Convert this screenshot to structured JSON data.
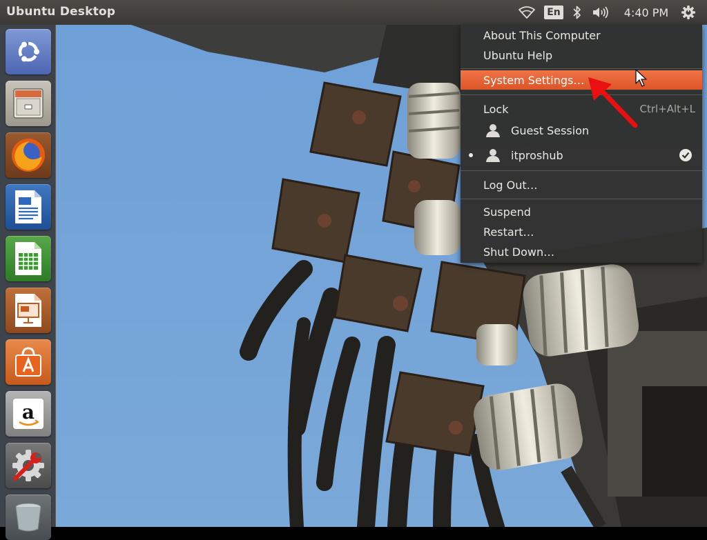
{
  "panel": {
    "title": "Ubuntu Desktop",
    "language": "En",
    "clock": "4:40 PM"
  },
  "launcher": {
    "items": [
      {
        "name": "Dash Home",
        "icon": "ubuntu-logo-icon"
      },
      {
        "name": "Files",
        "icon": "file-cabinet-icon"
      },
      {
        "name": "Firefox Web Browser",
        "icon": "firefox-icon"
      },
      {
        "name": "LibreOffice Writer",
        "icon": "writer-document-icon"
      },
      {
        "name": "LibreOffice Calc",
        "icon": "calc-spreadsheet-icon"
      },
      {
        "name": "LibreOffice Impress",
        "icon": "impress-presentation-icon"
      },
      {
        "name": "Ubuntu Software Center",
        "icon": "software-center-bag-icon"
      },
      {
        "name": "Amazon",
        "icon": "amazon-icon"
      },
      {
        "name": "System Settings",
        "icon": "settings-wrench-gear-icon"
      },
      {
        "name": "Trash",
        "icon": "trash-icon"
      }
    ]
  },
  "menu": {
    "about": "About This Computer",
    "help": "Ubuntu Help",
    "settings": "System Settings…",
    "lock": "Lock",
    "lock_accel": "Ctrl+Alt+L",
    "guest": "Guest Session",
    "user": "itproshub",
    "logout": "Log Out…",
    "suspend": "Suspend",
    "restart": "Restart…",
    "shutdown": "Shut Down…"
  },
  "colors": {
    "panel": "#3c3b37",
    "highlight": "#e95420",
    "sky": "#6f9fd6",
    "annotation": "#e81010"
  }
}
